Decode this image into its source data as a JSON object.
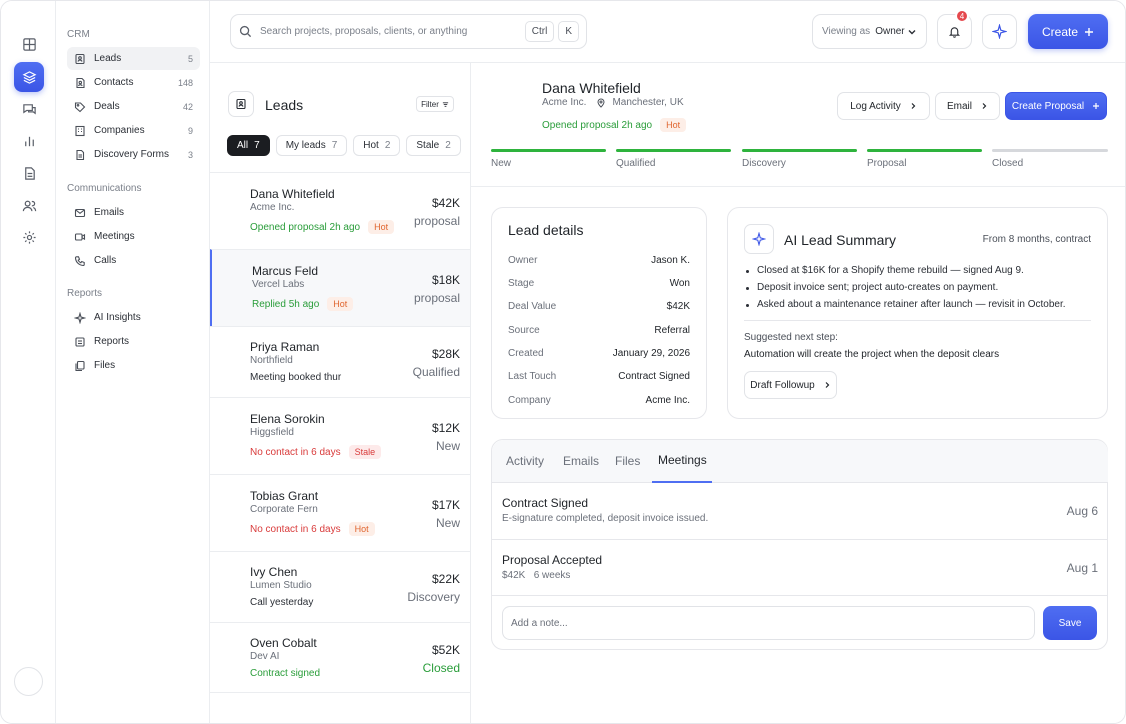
{
  "rail": {
    "icons": [
      "grid-icon",
      "layers-icon",
      "chat-icon",
      "bar-chart-icon",
      "document-icon",
      "users-icon",
      "gear-icon"
    ],
    "active": "layers-icon",
    "accent": "#4f6ef2"
  },
  "nav": {
    "crm_label": "CRM",
    "crm_items": [
      {
        "label": "Leads",
        "count": "5",
        "icon": "lead-book-icon"
      },
      {
        "label": "Contacts",
        "count": "148",
        "icon": "contacts-icon"
      },
      {
        "label": "Deals",
        "count": "42",
        "icon": "deal-tag-icon"
      },
      {
        "label": "Companies",
        "count": "9",
        "icon": "building-icon"
      },
      {
        "label": "Discovery Forms",
        "count": "3",
        "icon": "form-icon"
      }
    ],
    "comm_label": "Communications",
    "comm_items": [
      {
        "label": "Emails",
        "icon": "mail-icon"
      },
      {
        "label": "Meetings",
        "icon": "video-icon"
      },
      {
        "label": "Calls",
        "icon": "phone-icon"
      }
    ],
    "reports_label": "Reports",
    "reports_items": [
      {
        "label": "AI Insights",
        "icon": "sparkle-icon"
      },
      {
        "label": "Reports",
        "icon": "report-icon"
      },
      {
        "label": "Files",
        "icon": "files-icon"
      }
    ]
  },
  "topbar": {
    "search_placeholder": "Search projects, proposals, clients, or anything",
    "kbd1": "Ctrl",
    "kbd2": "K",
    "viewing_label": "Viewing as",
    "viewing_value": "Owner",
    "notif_count": "4",
    "create_label": "Create"
  },
  "leads": {
    "title": "Leads",
    "filter": "Filter",
    "chips": [
      {
        "label": "All",
        "n": "7"
      },
      {
        "label": "My leads",
        "n": "7"
      },
      {
        "label": "Hot",
        "n": "2"
      },
      {
        "label": "Stale",
        "n": "2"
      }
    ],
    "items": [
      {
        "name": "Dana Whitefield",
        "company": "Acme Inc.",
        "status": "Opened proposal 2h ago",
        "status_color": "green",
        "tag": "Hot",
        "amount": "$42K",
        "stage": "proposal"
      },
      {
        "name": "Marcus Feld",
        "company": "Vercel Labs",
        "status": "Replied 5h ago",
        "status_color": "green",
        "tag": "Hot",
        "amount": "$18K",
        "stage": "proposal"
      },
      {
        "name": "Priya Raman",
        "company": "Northfield",
        "status": "Meeting booked thur",
        "status_color": "gray",
        "tag": "",
        "amount": "$28K",
        "stage": "Qualified"
      },
      {
        "name": "Elena Sorokin",
        "company": "Higgsfield",
        "status": "No contact in 6 days",
        "status_color": "red",
        "tag": "Stale",
        "amount": "$12K",
        "stage": "New"
      },
      {
        "name": "Tobias Grant",
        "company": "Corporate Fern",
        "status": "No contact in 6 days",
        "status_color": "red",
        "tag": "Hot",
        "amount": "$17K",
        "stage": "New"
      },
      {
        "name": "Ivy Chen",
        "company": "Lumen Studio",
        "status": "Call yesterday",
        "status_color": "gray",
        "tag": "",
        "amount": "$22K",
        "stage": "Discovery"
      },
      {
        "name": "Oven Cobalt",
        "company": "Dev AI",
        "status": "Contract signed",
        "status_color": "green",
        "tag": "",
        "amount": "$52K",
        "stage": "Closed"
      }
    ]
  },
  "detail": {
    "name": "Dana Whitefield",
    "company": "Acme Inc.",
    "location": "Manchester, UK",
    "status": "Opened proposal 2h ago",
    "tag": "Hot",
    "buttons": {
      "log": "Log Activity",
      "email": "Email",
      "proposal": "Create Proposal"
    },
    "pipeline": [
      {
        "label": "New",
        "done": true
      },
      {
        "label": "Qualified",
        "done": true
      },
      {
        "label": "Discovery",
        "done": true
      },
      {
        "label": "Proposal",
        "done": true
      },
      {
        "label": "Closed",
        "done": false
      }
    ],
    "lead_details": {
      "title": "Lead details",
      "rows": [
        {
          "k": "Owner",
          "v": "Jason K."
        },
        {
          "k": "Stage",
          "v": "Won"
        },
        {
          "k": "Deal Value",
          "v": "$42K"
        },
        {
          "k": "Source",
          "v": "Referral"
        },
        {
          "k": "Created",
          "v": "January 29, 2026"
        },
        {
          "k": "Last Touch",
          "v": "Contract Signed"
        },
        {
          "k": "Company",
          "v": "Acme Inc."
        }
      ]
    },
    "ai": {
      "title": "AI Lead Summary",
      "from": "From 8 months, contract",
      "bullets": [
        "Closed at $16K for a Shopify theme rebuild — signed Aug 9.",
        "Deposit invoice sent; project auto-creates on payment.",
        "Asked about a maintenance retainer after launch — revisit in October."
      ],
      "suggest_label": "Suggested next step:",
      "suggest_text": "Automation will create the project when the deposit clears",
      "draft": "Draft Followup"
    },
    "tabs": [
      "Activity",
      "Emails",
      "Files",
      "Meetings"
    ],
    "active_tab": "Meetings",
    "events": [
      {
        "title": "Contract Signed",
        "sub": "E-signature completed, deposit invoice issued.",
        "date": "Aug 6"
      },
      {
        "title": "Proposal Accepted",
        "sub": "$42K   6 weeks",
        "date": "Aug 1"
      }
    ],
    "note_placeholder": "Add a note...",
    "save": "Save"
  }
}
